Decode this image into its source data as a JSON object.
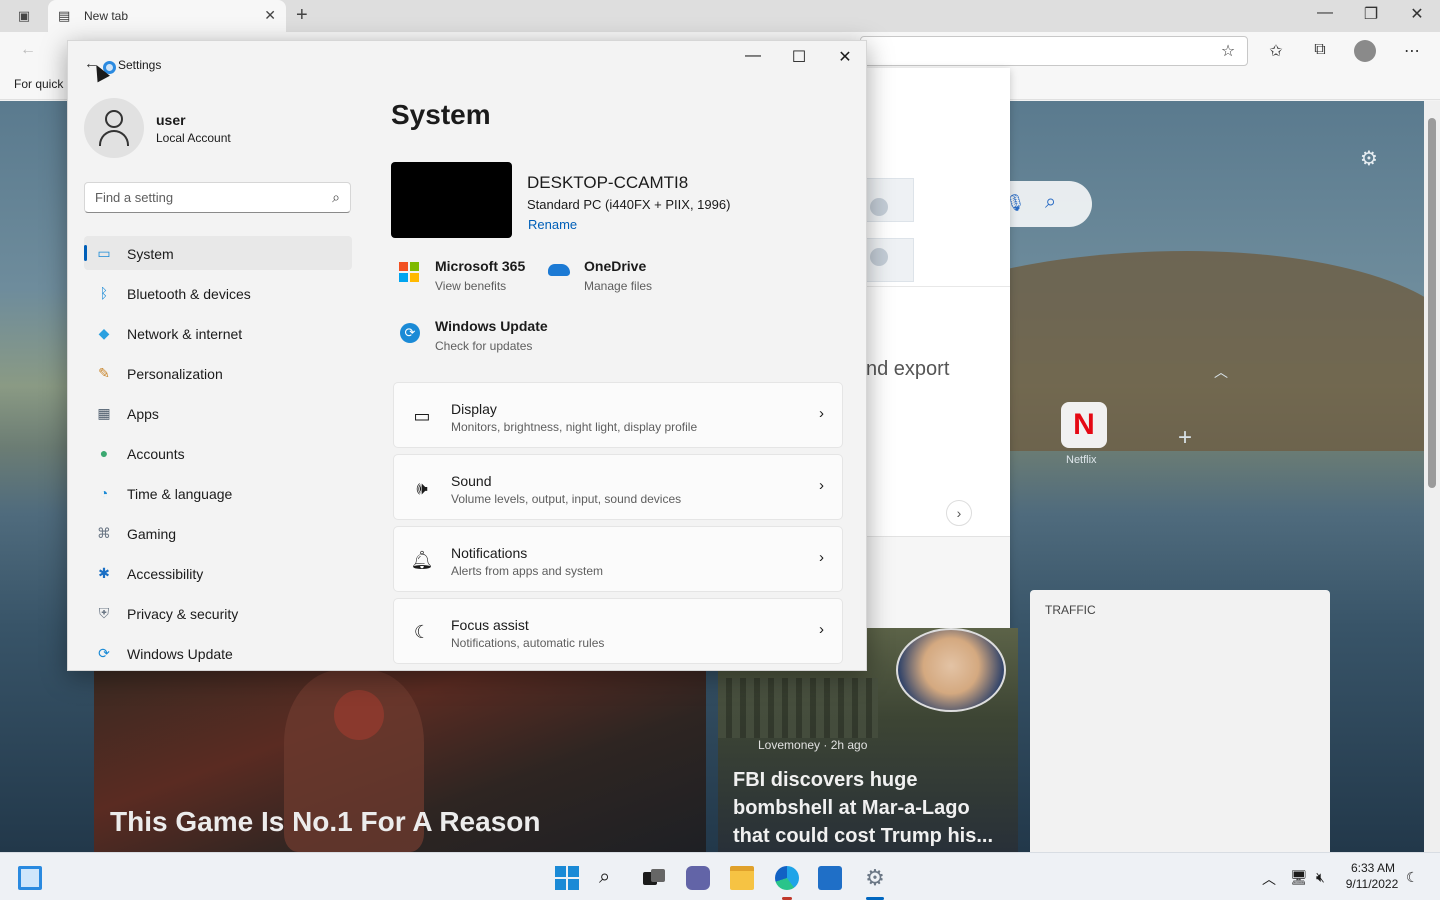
{
  "browser": {
    "tab_title": "New tab",
    "favorites_bar_text": "For quick",
    "new_tab_page": {
      "panel_text": "nd export",
      "top_sites": [
        {
          "label": "Netflix",
          "glyph": "N"
        }
      ],
      "traffic_label": "TRAFFIC",
      "news": [
        {
          "title": "This Game Is No.1 For A Reason"
        },
        {
          "source": "Lovemoney · 2h ago",
          "title": "FBI discovers huge bombshell at Mar-a-Lago that could cost Trump his..."
        }
      ]
    }
  },
  "settings": {
    "window_title": "Settings",
    "user": {
      "name": "user",
      "account_type": "Local Account"
    },
    "search": {
      "placeholder": "Find a setting"
    },
    "nav": [
      {
        "label": "System",
        "icon": "monitor-icon",
        "active": true
      },
      {
        "label": "Bluetooth & devices",
        "icon": "bluetooth-icon"
      },
      {
        "label": "Network & internet",
        "icon": "wifi-icon"
      },
      {
        "label": "Personalization",
        "icon": "brush-icon"
      },
      {
        "label": "Apps",
        "icon": "apps-icon"
      },
      {
        "label": "Accounts",
        "icon": "person-icon"
      },
      {
        "label": "Time & language",
        "icon": "globe-clock-icon"
      },
      {
        "label": "Gaming",
        "icon": "gamepad-icon"
      },
      {
        "label": "Accessibility",
        "icon": "accessibility-icon"
      },
      {
        "label": "Privacy & security",
        "icon": "shield-icon"
      },
      {
        "label": "Windows Update",
        "icon": "update-icon"
      }
    ],
    "page_title": "System",
    "device": {
      "name": "DESKTOP-CCAMTI8",
      "description": "Standard PC (i440FX + PIIX, 1996)",
      "rename_link": "Rename"
    },
    "quick_links": [
      {
        "title": "Microsoft 365",
        "subtitle": "View benefits",
        "icon": "microsoft-365-icon"
      },
      {
        "title": "OneDrive",
        "subtitle": "Manage files",
        "icon": "onedrive-icon"
      },
      {
        "title": "Windows Update",
        "subtitle": "Check for updates",
        "icon": "windows-update-icon"
      }
    ],
    "cards": [
      {
        "title": "Display",
        "subtitle": "Monitors, brightness, night light, display profile",
        "icon": "display-icon"
      },
      {
        "title": "Sound",
        "subtitle": "Volume levels, output, input, sound devices",
        "icon": "speaker-icon"
      },
      {
        "title": "Notifications",
        "subtitle": "Alerts from apps and system",
        "icon": "bell-icon"
      },
      {
        "title": "Focus assist",
        "subtitle": "Notifications, automatic rules",
        "icon": "moon-icon"
      }
    ]
  },
  "taskbar": {
    "time": "6:33 AM",
    "date": "9/11/2022"
  },
  "colors": {
    "accent": "#005fb8",
    "settings_bg": "#f3f3f3",
    "card_bg": "#fbfbfb"
  }
}
